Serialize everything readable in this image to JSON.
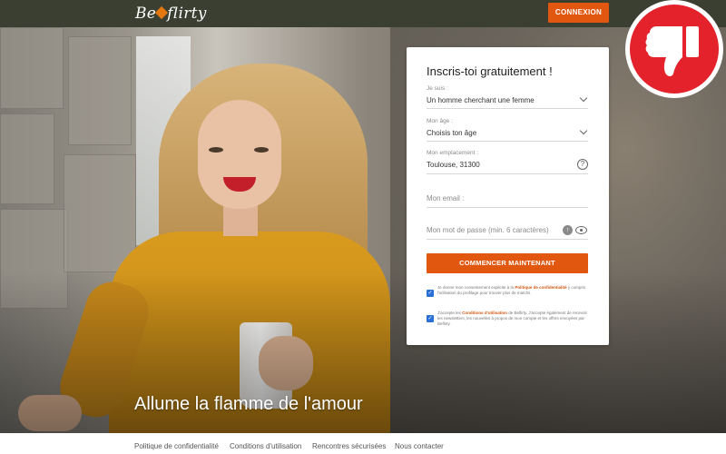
{
  "header": {
    "logo_text_left": "Be",
    "logo_text_right": "flirty",
    "login_label": "CONNEXION"
  },
  "hero": {
    "tagline": "Allume la flamme de l'amour"
  },
  "form": {
    "title": "Inscris-toi gratuitement !",
    "fields": {
      "gender": {
        "label": "Je suis :",
        "value": "Un homme cherchant une femme"
      },
      "age": {
        "label": "Mon âge :",
        "value": "Choisis ton âge"
      },
      "location": {
        "label": "Mon emplacement :",
        "value": "Toulouse, 31300"
      },
      "email": {
        "placeholder": "Mon email :"
      },
      "password": {
        "placeholder": "Mon mot de passe (min. 6 caractères)"
      }
    },
    "submit_label": "COMMENCER MAINTENANT",
    "consent1": {
      "prefix": "Je donne mon consentement explicite à la",
      "link": "Politique de confidentialité",
      "suffix": "y compris l'utilisation du profilage pour trouver plus de matchs"
    },
    "consent2": {
      "prefix": "J'accepte les",
      "link": "Conditions d'utilisation",
      "suffix": "de Beflirty. J'accepte également de recevoir les newsletters, les nouvelles à propos de mon compte et les offres envoyées par Beflirty."
    }
  },
  "footer": {
    "links": [
      "Politique de confidentialité",
      "Conditions d'utilisation",
      "Rencontres sécurisées",
      "Nous contacter"
    ]
  },
  "colors": {
    "accent": "#e2570f",
    "header_bg": "#3b3f32",
    "badge_red": "#e3222b"
  },
  "icons": {
    "badge": "thumbs-down-icon",
    "location_help": "question-circle-icon",
    "password_generate": "key-icon",
    "password_show": "eye-icon"
  }
}
